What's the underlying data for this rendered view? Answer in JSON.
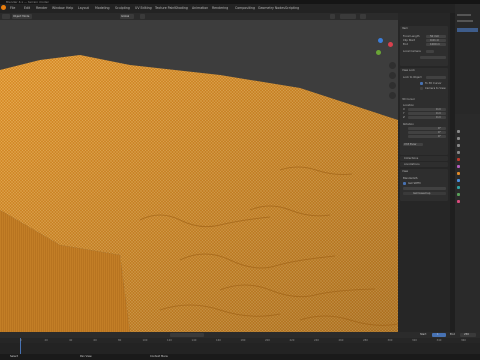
{
  "window": {
    "title": "Blender 4.x — terrain model"
  },
  "menu": {
    "items": [
      "File",
      "Edit",
      "Render",
      "Window",
      "Help",
      "Layout",
      "Modeling",
      "Sculpting",
      "UV Editing",
      "Texture Paint",
      "Shading",
      "Animation",
      "Rendering",
      "Compositing",
      "Geometry Nodes",
      "Scripting"
    ]
  },
  "viewport": {
    "mode": "Object Mode",
    "shading_label": "Global"
  },
  "npanel": {
    "item_header": "Item",
    "transform_header": "Transform",
    "labels": [
      "Focal Length",
      "Clip Start",
      "End"
    ],
    "values": [
      "50 mm",
      "0.01 m",
      "1000 m"
    ],
    "local_camera": "Local Camera",
    "view_lock": "View Lock",
    "lock_to_object": "Lock to Object",
    "lock_to_3d_cursor": "To 3D Cursor",
    "lock_camera_to_view": "Camera to View",
    "cursor_header": "3D Cursor",
    "location": "Location",
    "axes": [
      "X",
      "Y",
      "Z"
    ],
    "loc_values": [
      "0 m",
      "0 m",
      "0 m"
    ],
    "rotation": "Rotation",
    "rot_values": [
      "0°",
      "0°",
      "0°"
    ],
    "rotation_mode": "XYZ Euler",
    "collections": "Collections",
    "annotations": "Annotations",
    "viewtab": "View",
    "blendergis": "BlenderGIS",
    "get_srtm": "Get SRTM",
    "get_basemap": "Get basemap"
  },
  "timeline": {
    "ticks": [
      "0",
      "20",
      "40",
      "60",
      "80",
      "100",
      "120",
      "140",
      "160",
      "180",
      "200",
      "220",
      "240",
      "260",
      "280",
      "300",
      "320",
      "340",
      "360"
    ],
    "start_label": "Start",
    "start": "1",
    "end_label": "End",
    "end": "250"
  },
  "status": {
    "left": "Select",
    "mid": "Pan View",
    "right": "Context Menu"
  },
  "colors": {
    "terrain": "#f0a23a",
    "terrain_dark": "#a86a1c",
    "viewport": "#3d3d3d",
    "accent": "#4772b3"
  }
}
